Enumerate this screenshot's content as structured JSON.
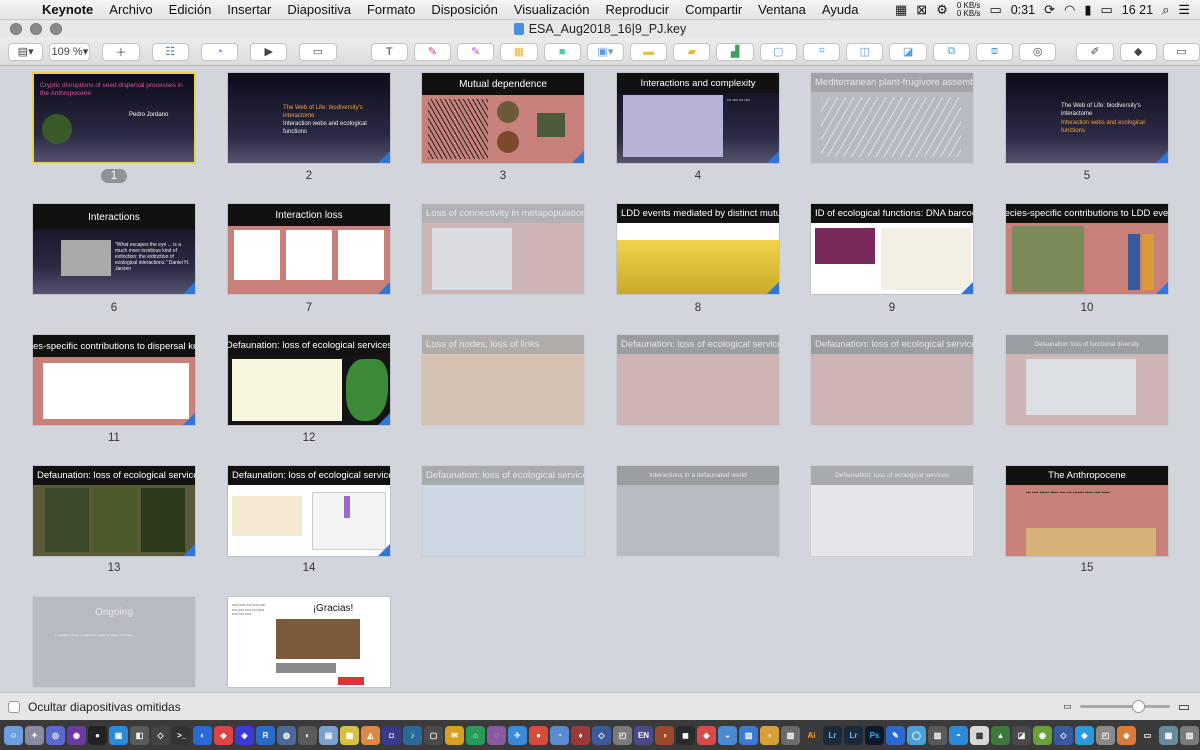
{
  "menubar": {
    "app": "Keynote",
    "items": [
      "Archivo",
      "Edición",
      "Insertar",
      "Diapositiva",
      "Formato",
      "Disposición",
      "Visualización",
      "Reproducir",
      "Compartir",
      "Ventana",
      "Ayuda"
    ],
    "net_up": "0 KB/s",
    "net_down": "0 KB/s",
    "timer": "0:31",
    "clock": "16 21"
  },
  "window": {
    "title": "ESA_Aug2018_16|9_PJ.key"
  },
  "toolbar": {
    "zoom": "109 %"
  },
  "slides": [
    {
      "num": "1",
      "title": "Cryptic disruptions of seed dispersal processes in the Anthropocene",
      "author": "Pedro Jordano",
      "skip": false
    },
    {
      "num": "2",
      "title": "The Web of Life: biodiversity's interactome",
      "sub": "Interaction webs and ecological functions",
      "skip": false
    },
    {
      "num": "3",
      "title": "Mutual dependence",
      "skip": false
    },
    {
      "num": "4",
      "title": "Interactions and complexity",
      "skip": false
    },
    {
      "num": "",
      "title": "Mediterranean plant-frugivore assemblage",
      "skip": true
    },
    {
      "num": "5",
      "title": "The Web of Life: biodiversity's interactome",
      "sub": "Interaction webs and ecological functions",
      "skip": false
    },
    {
      "num": "6",
      "title": "Interactions",
      "quote": "\"What escapes the eye ... is a much more insidious kind of extinction: the extinction of ecological interactions.\" Daniel H. Janzen",
      "skip": false
    },
    {
      "num": "7",
      "title": "Interaction loss",
      "skip": false
    },
    {
      "num": "",
      "title": "Loss of connectivity in metapopulation scenarios",
      "skip": true
    },
    {
      "num": "8",
      "title": "LDD events mediated by distinct mutualists",
      "skip": false
    },
    {
      "num": "9",
      "title": "ID of ecological functions: DNA barcoding",
      "skip": false
    },
    {
      "num": "10",
      "title": "Species-specific contributions to LDD events",
      "skip": false
    },
    {
      "num": "11",
      "title": "Species-specific contributions to dispersal kernels",
      "skip": false
    },
    {
      "num": "12",
      "title": "Defaunation: loss of ecological services",
      "skip": false
    },
    {
      "num": "",
      "title": "Loss of nodes, loss of links",
      "skip": true
    },
    {
      "num": "",
      "title": "Defaunation: loss of ecological services",
      "skip": true
    },
    {
      "num": "",
      "title": "Defaunation: loss of ecological services",
      "skip": true
    },
    {
      "num": "",
      "title": "Defaunation: loss of functional diversity",
      "skip": true
    },
    {
      "num": "13",
      "title": "Defaunation: loss of ecological services",
      "skip": false
    },
    {
      "num": "14",
      "title": "Defaunation: loss of ecological services",
      "skip": false
    },
    {
      "num": "",
      "title": "Defaunation: loss of ecological services",
      "skip": true
    },
    {
      "num": "",
      "title": "Interactions in a defaunated world",
      "skip": true
    },
    {
      "num": "",
      "title": "Defaunation: loss of ecological services",
      "skip": true
    },
    {
      "num": "15",
      "title": "The Anthropocene",
      "skip": false
    },
    {
      "num": "",
      "title": "Ongoing",
      "skip": true
    },
    {
      "num": "",
      "title": "¡Gracias!",
      "skip": false
    }
  ],
  "bottombar": {
    "hide_skipped_label": "Ocultar diapositivas omitidas"
  },
  "colors": {
    "accent": "#2f76d6",
    "selection": "#e8d24a",
    "canvas": "#d2d6dc"
  }
}
